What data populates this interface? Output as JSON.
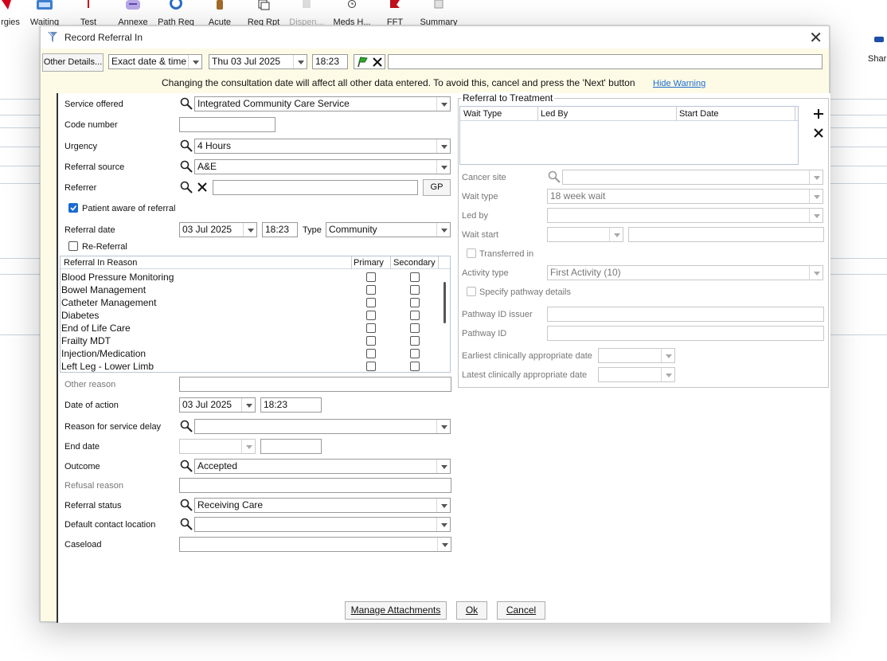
{
  "toolbar": {
    "items": [
      "rgies",
      "Waiting",
      "Test",
      "Annexe",
      "Path Req",
      "Acute",
      "Req Rpt",
      "Dispen...",
      "Meds H...",
      "FFT",
      "Summary"
    ],
    "share": "Shar"
  },
  "dialog": {
    "title": "Record Referral In",
    "other_details": "Other Details...",
    "date_mode": "Exact date & time",
    "date": "Thu 03 Jul 2025",
    "time": "18:23",
    "free_text": "",
    "warning": "Changing the consultation date will affect all other data entered. To avoid this, cancel and press the 'Next' button",
    "hide_warning": "Hide Warning"
  },
  "form": {
    "service_offered": {
      "label": "Service offered",
      "value": "Integrated Community Care Service"
    },
    "code_number": {
      "label": "Code number",
      "value": ""
    },
    "urgency": {
      "label": "Urgency",
      "value": "4 Hours"
    },
    "referral_source": {
      "label": "Referral source",
      "value": "A&E"
    },
    "referrer": {
      "label": "Referrer",
      "value": "",
      "gp": "GP"
    },
    "patient_aware": {
      "label": "Patient aware of referral",
      "checked": true
    },
    "referral_date": {
      "label": "Referral date",
      "date": "03 Jul 2025",
      "time": "18:23",
      "type_label": "Type",
      "type": "Community"
    },
    "re_referral": {
      "label": "Re-Referral",
      "checked": false
    },
    "reasons": {
      "headers": [
        "Referral In Reason",
        "Primary",
        "Secondary"
      ],
      "items": [
        "Blood Pressure Monitoring",
        "Bowel Management",
        "Catheter Management",
        "Diabetes",
        "End of Life Care",
        "Frailty MDT",
        "Injection/Medication",
        "Left Leg - Lower Limb"
      ]
    },
    "other_reason": {
      "label": "Other reason",
      "value": ""
    },
    "date_of_action": {
      "label": "Date of action",
      "date": "03 Jul 2025",
      "time": "18:23"
    },
    "service_delay": {
      "label": "Reason for service delay",
      "value": ""
    },
    "end_date": {
      "label": "End date",
      "date": "",
      "time": ""
    },
    "outcome": {
      "label": "Outcome",
      "value": "Accepted"
    },
    "refusal_reason": {
      "label": "Refusal reason",
      "value": ""
    },
    "referral_status": {
      "label": "Referral status",
      "value": "Receiving Care"
    },
    "default_contact": {
      "label": "Default contact location",
      "value": ""
    },
    "caseload": {
      "label": "Caseload",
      "value": ""
    }
  },
  "rtt": {
    "title": "Referral to Treatment",
    "headers": [
      "Wait Type",
      "Led By",
      "Start Date"
    ],
    "cancer_site": {
      "label": "Cancer site",
      "value": ""
    },
    "wait_type": {
      "label": "Wait type",
      "value": "18 week wait"
    },
    "led_by": {
      "label": "Led by",
      "value": ""
    },
    "wait_start": {
      "label": "Wait start",
      "value": ""
    },
    "transferred_in": {
      "label": "Transferred in",
      "checked": false
    },
    "activity_type": {
      "label": "Activity type",
      "value": "First Activity (10)"
    },
    "specify_pathway": {
      "label": "Specify pathway details",
      "checked": false
    },
    "pathway_issuer": {
      "label": "Pathway ID issuer",
      "value": ""
    },
    "pathway_id": {
      "label": "Pathway ID",
      "value": ""
    },
    "earliest_date": {
      "label": "Earliest clinically appropriate date",
      "value": ""
    },
    "latest_date": {
      "label": "Latest clinically appropriate date",
      "value": ""
    }
  },
  "buttons": {
    "manage": "Manage Attachments",
    "ok": "Ok",
    "cancel": "Cancel"
  },
  "colors": {
    "dialog_bg": "#fdfbe6",
    "link": "#1a6bd1",
    "checkbox_on": "#1a6bd1"
  }
}
